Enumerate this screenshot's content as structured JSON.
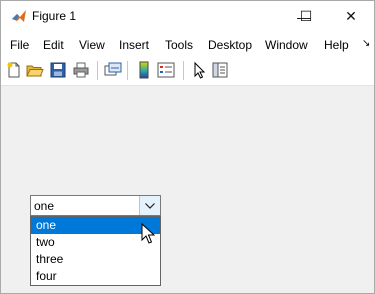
{
  "window": {
    "title": "Figure 1",
    "controls": {
      "minimize": "—",
      "maximize": "☐",
      "close": "✕"
    }
  },
  "menubar": {
    "items": [
      "File",
      "Edit",
      "View",
      "Insert",
      "Tools",
      "Desktop",
      "Window",
      "Help"
    ],
    "overflow_glyph": "↘"
  },
  "toolbar": {
    "icons": [
      "new-figure-icon",
      "open-file-icon",
      "save-figure-icon",
      "print-figure-icon",
      "link-plot-icon",
      "insert-colorbar-icon",
      "insert-legend-icon",
      "edit-plot-icon",
      "property-inspector-icon"
    ]
  },
  "popup": {
    "selected": "one",
    "options": [
      "one",
      "two",
      "three",
      "four"
    ],
    "highlighted_index": 0
  },
  "colors": {
    "selection": "#0078d7",
    "figure_background": "#f0f0f0",
    "title_icon_accent": "#e06c1a"
  }
}
